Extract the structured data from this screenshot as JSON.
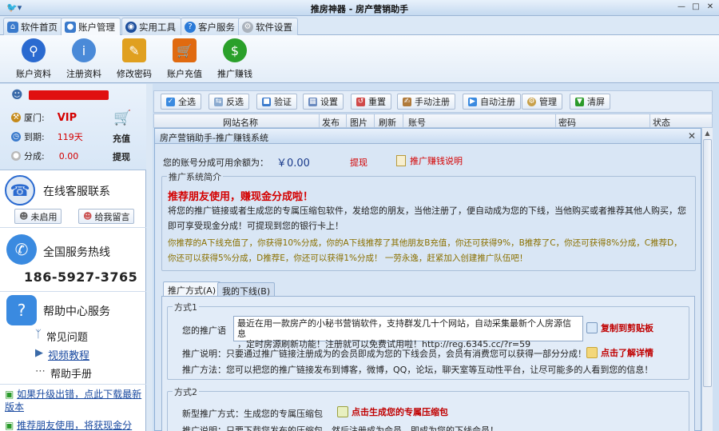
{
  "window": {
    "title": "推房神器 - 房产营销助手",
    "logo_icon": "bird-icon"
  },
  "tabs": [
    {
      "label": "软件首页",
      "icon": "home-icon"
    },
    {
      "label": "账户管理",
      "icon": "user-icon"
    },
    {
      "label": "实用工具",
      "icon": "tools-icon"
    },
    {
      "label": "客户服务",
      "icon": "help-icon"
    },
    {
      "label": "软件设置",
      "icon": "gear-icon"
    }
  ],
  "active_tab": "账户管理",
  "ribbon": [
    {
      "label": "账户资料",
      "icon": "user-search-icon",
      "color": "#2a6ad0"
    },
    {
      "label": "注册资料",
      "icon": "user-info-icon",
      "color": "#4a8ad8"
    },
    {
      "label": "修改密码",
      "icon": "pen-icon",
      "color": "#e0a020"
    },
    {
      "label": "账户充值",
      "icon": "cart-icon",
      "color": "#e06a10"
    },
    {
      "label": "推广赚钱",
      "icon": "dollar-icon",
      "color": "#2aa02a"
    }
  ],
  "account": {
    "level_label": "厦门:",
    "level_value": "VIP",
    "expire_label": "到期:",
    "expire_value": "119天",
    "share_label": "分成:",
    "share_value": "0.00",
    "recharge": "充值",
    "withdraw": "提现"
  },
  "left": {
    "online_title": "在线客服联系",
    "btn_not_enabled": "未启用",
    "btn_message": "给我留言",
    "hotline_title": "全国服务热线",
    "hotline_number": "186-5927-3765",
    "help_title": "帮助中心服务",
    "help_items": [
      "常见问题",
      "视频教程",
      "帮助手册"
    ],
    "news": [
      "如果升级出错，点此下载最新版本",
      "推荐朋友使用，将获现金分"
    ]
  },
  "toolbar": [
    "全选",
    "反选",
    "验证",
    "设置",
    "重置",
    "手动注册",
    "自动注册",
    "管理",
    "清屏"
  ],
  "grid_columns": [
    "网站名称",
    "发布",
    "图片",
    "刷新",
    "账号",
    "密码",
    "状态"
  ],
  "panel": {
    "title": "房产营销助手-推广赚钱系统",
    "balance_label": "您的账号分成可用余额为：",
    "balance_value": "￥0.00",
    "withdraw_link": "提现",
    "explain_link": "推广赚钱说明",
    "intro_legend": "推广系统简介",
    "intro_headline": "推荐朋友使用，赚现金分成啦！",
    "intro_text": "将您的推广链接或者生成您的专属压缩包软件，发给您的朋友，当他注册了，便自动成为您的下线，当他购买或者推荐其他人购买，您即可享受现金分成！可提现到您的银行卡上！",
    "intro_gold": "你推荐的A下线充值了，你获得10%分成，你的A下线推荐了其他朋友B充值，你还可获得9%，B推荐了C，你还可获得8%分成，C推荐D，你还可以获得5%分成，D推荐E，你还可以获得1%分成！ 一劳永逸，赶紧加入创建推广队伍吧！",
    "subtabs": [
      "推广方式(A)",
      "我的下线(B)"
    ],
    "m1_legend": "方式1",
    "m1_label": "您的推广语",
    "m1_text_1": "最近在用一款房产的小秘书营销软件，支持群发几十个网站，自动采集最新个人房源信息",
    "m1_text_2": "，定时房源刷新功能！注册就可以免费试用啦！http://reg.6345.cc/?r=59",
    "m1_copy": "复制到剪贴板",
    "m1_note": "推广说明：只要通过推广链接注册成为的会员即成为您的下线会员，会员有消费您可以获得一部分分成！",
    "m1_detail": "点击了解详情",
    "m1_method": "推广方法：您可以把您的推广链接发布到博客，微博，QQ，论坛，聊天室等互动性平台，让尽可能多的人看到您的信息！",
    "m2_legend": "方式2",
    "m2_label": "新型推广方式：生成您的专属压缩包",
    "m2_link": "点击生成您的专属压缩包",
    "m2_note": "推广说明：只要下载您发布的压缩包，然后注册成为会员，即成为您的下线会员！"
  },
  "colors": {
    "accent": "#2a6ad0",
    "red": "#d40000",
    "gold": "#8a7000"
  }
}
